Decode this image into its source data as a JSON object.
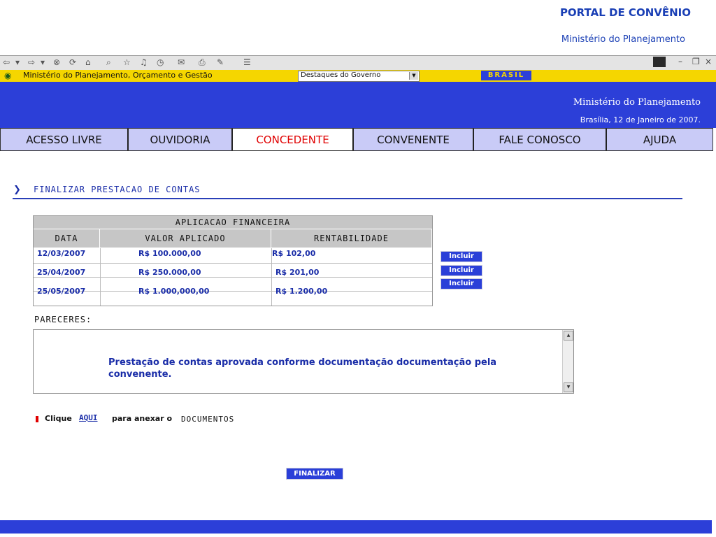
{
  "header": {
    "portal_title": "PORTAL DE CONVÊNIO",
    "portal_subtitle": "Ministério do Planejamento"
  },
  "gov_bar": {
    "title": "Ministério do Planejamento, Orçamento e Gestão",
    "select_value": "Destaques do Governo",
    "brasil_logo": "BRASIL"
  },
  "banner": {
    "ministry": "Ministério do Planejamento",
    "date": "Brasília, 12 de Janeiro de 2007."
  },
  "nav": {
    "tabs": [
      {
        "label": "ACESSO LIVRE"
      },
      {
        "label": "OUVIDORIA"
      },
      {
        "label": "CONCEDENTE"
      },
      {
        "label": "CONVENENTE"
      },
      {
        "label": "FALE CONOSCO"
      },
      {
        "label": "AJUDA"
      }
    ],
    "active_index": 2
  },
  "section": {
    "title": "FINALIZAR PRESTACAO DE CONTAS"
  },
  "table": {
    "title": "APLICACAO FINANCEIRA",
    "columns": [
      "DATA",
      "VALOR APLICADO",
      "RENTABILIDADE"
    ],
    "rows": [
      {
        "data": "12/03/2007",
        "valor": "R$ 100.000,00",
        "rent": "R$ 102,00"
      },
      {
        "data": "25/04/2007",
        "valor": "R$ 250.000,00",
        "rent": "R$ 201,00"
      },
      {
        "data": "25/05/2007",
        "valor": "R$ 1.000,000,00",
        "rent": "R$ 1.200,00"
      }
    ],
    "include_label": "Incluir"
  },
  "pareceres": {
    "label": "PARECERES:",
    "text": "Prestação de contas aprovada conforme documentação documentação pela convenente."
  },
  "attach": {
    "prefix": "Clique",
    "link": "AQUI",
    "middle": "para anexar o",
    "suffix": "DOCUMENTOS"
  },
  "actions": {
    "finalize_label": "FINALIZAR"
  },
  "colors": {
    "brand_blue": "#2c3fd8",
    "gov_yellow": "#f5d600",
    "active_tab": "#e00000",
    "nav_bg": "#c9cbf7"
  }
}
